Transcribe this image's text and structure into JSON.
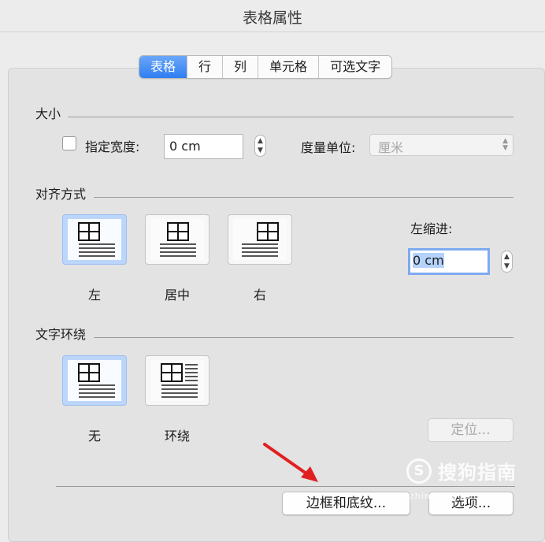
{
  "window": {
    "title": "表格属性"
  },
  "tabs": [
    {
      "label": "表格",
      "active": true
    },
    {
      "label": "行",
      "active": false
    },
    {
      "label": "列",
      "active": false
    },
    {
      "label": "单元格",
      "active": false
    },
    {
      "label": "可选文字",
      "active": false
    }
  ],
  "size": {
    "section_label": "大小",
    "preferred_width_label": "指定宽度:",
    "preferred_width_checked": false,
    "preferred_width_value": "0 cm",
    "measure_unit_label": "度量单位:",
    "measure_unit_value": "厘米"
  },
  "alignment": {
    "section_label": "对齐方式",
    "options": [
      {
        "label": "左",
        "selected": true
      },
      {
        "label": "居中",
        "selected": false
      },
      {
        "label": "右",
        "selected": false
      }
    ],
    "indent_label": "左缩进:",
    "indent_value": "0 cm"
  },
  "wrapping": {
    "section_label": "文字环绕",
    "options": [
      {
        "label": "无",
        "selected": true
      },
      {
        "label": "环绕",
        "selected": false
      }
    ],
    "position_button": "定位..."
  },
  "footer": {
    "borders_button": "边框和底纹...",
    "options_button": "选项..."
  },
  "watermark": {
    "logo_letter": "S",
    "text": "搜狗指南",
    "url": "zhinan.sogou.com"
  },
  "colors": {
    "accent": "#2f7ef1",
    "selected_option": "#bcd6fb",
    "arrow": "#e02020"
  }
}
